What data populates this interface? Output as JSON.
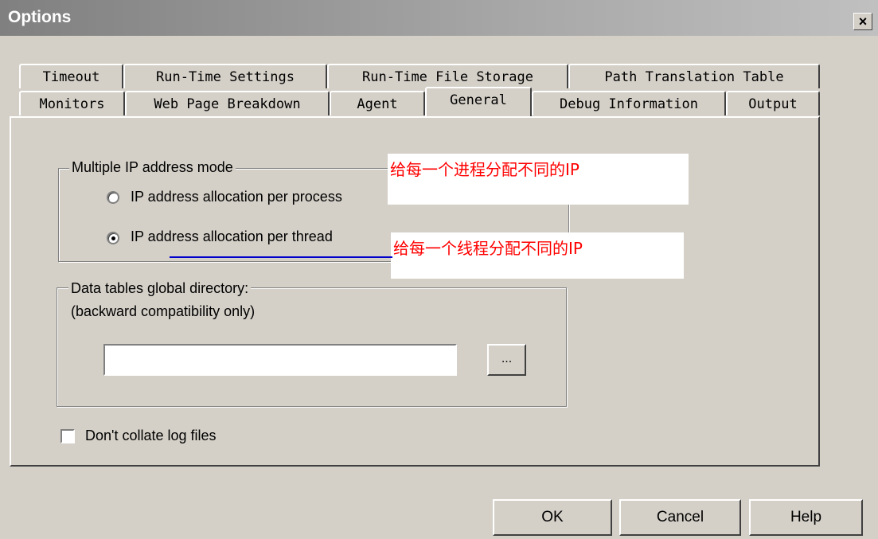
{
  "window": {
    "title": "Options",
    "close_glyph": "×"
  },
  "tabs_back_row": [
    "Timeout",
    "Run-Time Settings",
    "Run-Time File Storage",
    "Path Translation Table"
  ],
  "tabs_front_row": [
    "Monitors",
    "Web Page Breakdown",
    "Agent",
    "General",
    "Debug Information",
    "Output"
  ],
  "active_tab": "General",
  "ip_group": {
    "legend": "Multiple IP address mode",
    "option_process": "IP address allocation per process",
    "option_thread": "IP address allocation per thread",
    "selected": "thread"
  },
  "annotations": {
    "process_note": "给每一个进程分配不同的IP",
    "thread_note": "给每一个线程分配不同的IP",
    "color": "#ff0000",
    "underline_color": "#0000cc"
  },
  "data_tables_group": {
    "legend_line1": "Data tables global directory:",
    "legend_line2": "(backward compatibility only)",
    "directory_value": "",
    "browse_label": "..."
  },
  "collate_checkbox": {
    "label": "Don't collate log files",
    "checked": false
  },
  "buttons": {
    "ok": "OK",
    "cancel": "Cancel",
    "help": "Help"
  }
}
